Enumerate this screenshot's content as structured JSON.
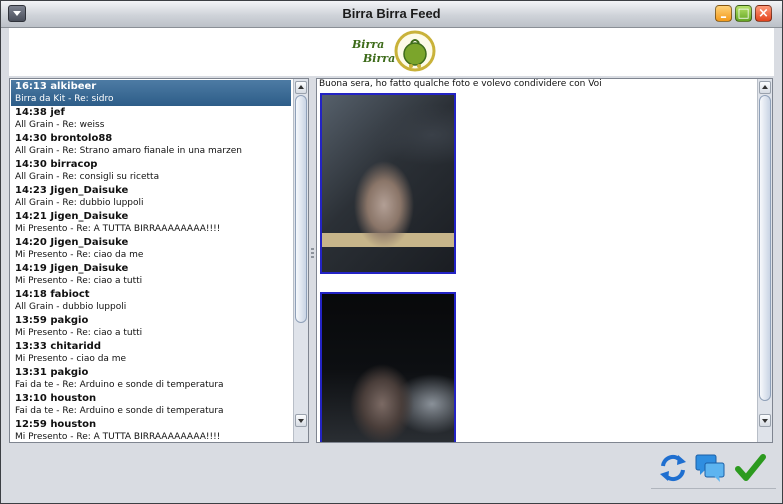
{
  "window": {
    "title": "Birra Birra Feed"
  },
  "logo": {
    "line1": "Birra",
    "line2": "Birra",
    "colors": {
      "text": "#3d6b1a",
      "hop": "#7ba52b",
      "ring": "#c9b23a"
    }
  },
  "feed": {
    "items": [
      {
        "time_user": "16:13 alkibeer",
        "subject": "Birra da Kit - Re: sidro",
        "selected": true
      },
      {
        "time_user": "14:38 jef",
        "subject": "All Grain - Re: weiss"
      },
      {
        "time_user": "14:30 brontolo88",
        "subject": "All Grain - Re: Strano amaro fianale in una marzen"
      },
      {
        "time_user": "14:30 birracop",
        "subject": "All Grain - Re: consigli su ricetta"
      },
      {
        "time_user": "14:23 Jigen_Daisuke",
        "subject": "All Grain - Re: dubbio luppoli"
      },
      {
        "time_user": "14:21 Jigen_Daisuke",
        "subject": "Mi Presento - Re: A TUTTA BIRRAAAAAAAA!!!!"
      },
      {
        "time_user": "14:20 Jigen_Daisuke",
        "subject": "Mi Presento - Re: ciao da me"
      },
      {
        "time_user": "14:19 Jigen_Daisuke",
        "subject": "Mi Presento - Re: ciao a tutti"
      },
      {
        "time_user": "14:18 fabioct",
        "subject": "All Grain - dubbio luppoli"
      },
      {
        "time_user": "13:59 pakgio",
        "subject": "Mi Presento - Re: ciao a tutti"
      },
      {
        "time_user": "13:33 chitaridd",
        "subject": "Mi Presento - ciao da me"
      },
      {
        "time_user": "13:31 pakgio",
        "subject": "Fai da te - Re: Arduino e sonde di temperatura"
      },
      {
        "time_user": "13:10 houston",
        "subject": "Fai da te - Re: Arduino e sonde di temperatura"
      },
      {
        "time_user": "12:59 houston",
        "subject": "Mi Presento - Re: A TUTTA BIRRAAAAAAAA!!!!"
      }
    ]
  },
  "post": {
    "text": "Buona sera, ho fatto qualche foto e volevo condividere con Voi"
  },
  "actions": {
    "refresh_icon": "refresh-icon",
    "chat_icon": "chat-icon",
    "ok_icon": "checkmark-icon"
  }
}
